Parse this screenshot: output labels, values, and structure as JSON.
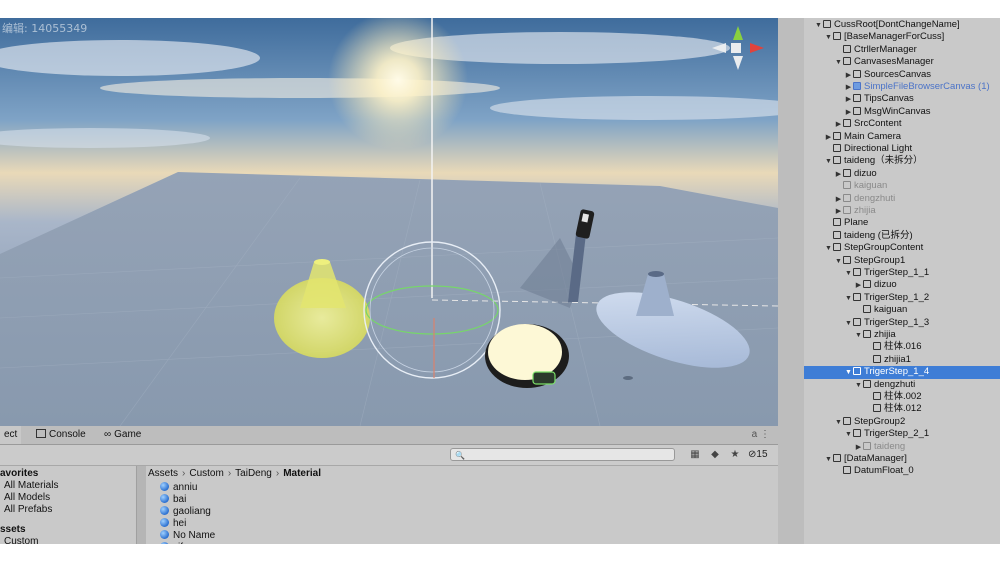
{
  "scene": {
    "watermark": "编辑: 14055349"
  },
  "bottom": {
    "tabs": [
      {
        "label": "ect",
        "icon": ""
      },
      {
        "label": "Console",
        "icon": "console-icon"
      },
      {
        "label": "Game",
        "icon": "game-icon"
      }
    ],
    "lock_glyph": "a",
    "search_placeholder": "🔍",
    "hidden_count": "15",
    "favorites_header": "avorites",
    "favorites": [
      "All Materials",
      "All Models",
      "All Prefabs"
    ],
    "assets_header": "ssets",
    "assets_child": "Custom",
    "breadcrumb": [
      "Assets",
      "Custom",
      "TaiDeng",
      "Material"
    ],
    "materials": [
      "anniu",
      "bai",
      "gaoliang",
      "hei",
      "No Name",
      "zifaguang"
    ]
  },
  "hierarchy": [
    {
      "label": "CussRoot[DontChangeName]",
      "indent": 0,
      "arrow": "▼",
      "style": ""
    },
    {
      "label": "[BaseManagerForCuss]",
      "indent": 1,
      "arrow": "▼",
      "style": ""
    },
    {
      "label": "CtrllerManager",
      "indent": 2,
      "arrow": "",
      "style": ""
    },
    {
      "label": "CanvasesManager",
      "indent": 2,
      "arrow": "▼",
      "style": ""
    },
    {
      "label": "SourcesCanvas",
      "indent": 3,
      "arrow": "▶",
      "style": ""
    },
    {
      "label": "SimpleFileBrowserCanvas (1)",
      "indent": 3,
      "arrow": "▶",
      "style": "blue"
    },
    {
      "label": "TipsCanvas",
      "indent": 3,
      "arrow": "▶",
      "style": ""
    },
    {
      "label": "MsgWinCanvas",
      "indent": 3,
      "arrow": "▶",
      "style": ""
    },
    {
      "label": "SrcContent",
      "indent": 2,
      "arrow": "▶",
      "style": ""
    },
    {
      "label": "Main Camera",
      "indent": 1,
      "arrow": "▶",
      "style": ""
    },
    {
      "label": "Directional Light",
      "indent": 1,
      "arrow": "",
      "style": ""
    },
    {
      "label": "taideng（未拆分）",
      "indent": 1,
      "arrow": "▼",
      "style": ""
    },
    {
      "label": "dizuo",
      "indent": 2,
      "arrow": "▶",
      "style": ""
    },
    {
      "label": "kaiguan",
      "indent": 2,
      "arrow": "",
      "style": "dim"
    },
    {
      "label": "dengzhuti",
      "indent": 2,
      "arrow": "▶",
      "style": "dim"
    },
    {
      "label": "zhijia",
      "indent": 2,
      "arrow": "▶",
      "style": "dim"
    },
    {
      "label": "Plane",
      "indent": 1,
      "arrow": "",
      "style": ""
    },
    {
      "label": "taideng (已拆分)",
      "indent": 1,
      "arrow": "",
      "style": ""
    },
    {
      "label": "StepGroupContent",
      "indent": 1,
      "arrow": "▼",
      "style": ""
    },
    {
      "label": "StepGroup1",
      "indent": 2,
      "arrow": "▼",
      "style": ""
    },
    {
      "label": "TrigerStep_1_1",
      "indent": 3,
      "arrow": "▼",
      "style": ""
    },
    {
      "label": "dizuo",
      "indent": 4,
      "arrow": "▶",
      "style": ""
    },
    {
      "label": "TrigerStep_1_2",
      "indent": 3,
      "arrow": "▼",
      "style": ""
    },
    {
      "label": "kaiguan",
      "indent": 4,
      "arrow": "",
      "style": ""
    },
    {
      "label": "TrigerStep_1_3",
      "indent": 3,
      "arrow": "▼",
      "style": ""
    },
    {
      "label": "zhijia",
      "indent": 4,
      "arrow": "▼",
      "style": ""
    },
    {
      "label": "柱体.016",
      "indent": 5,
      "arrow": "",
      "style": ""
    },
    {
      "label": "zhijia1",
      "indent": 5,
      "arrow": "",
      "style": ""
    },
    {
      "label": "TrigerStep_1_4",
      "indent": 3,
      "arrow": "▼",
      "style": "sel"
    },
    {
      "label": "dengzhuti",
      "indent": 4,
      "arrow": "▼",
      "style": ""
    },
    {
      "label": "柱体.002",
      "indent": 5,
      "arrow": "",
      "style": ""
    },
    {
      "label": "柱体.012",
      "indent": 5,
      "arrow": "",
      "style": ""
    },
    {
      "label": "StepGroup2",
      "indent": 2,
      "arrow": "▼",
      "style": ""
    },
    {
      "label": "TrigerStep_2_1",
      "indent": 3,
      "arrow": "▼",
      "style": ""
    },
    {
      "label": "taideng",
      "indent": 4,
      "arrow": "▶",
      "style": "dim"
    },
    {
      "label": "[DataManager]",
      "indent": 1,
      "arrow": "▼",
      "style": ""
    },
    {
      "label": "DatumFloat_0",
      "indent": 2,
      "arrow": "",
      "style": ""
    }
  ],
  "colors": {
    "selection": "#3e7dd6",
    "panel": "#c9c9c9",
    "ground": "#8e9db2",
    "sky_top": "#3e6b9a",
    "highlight_yellow": "#e8ea7a"
  }
}
